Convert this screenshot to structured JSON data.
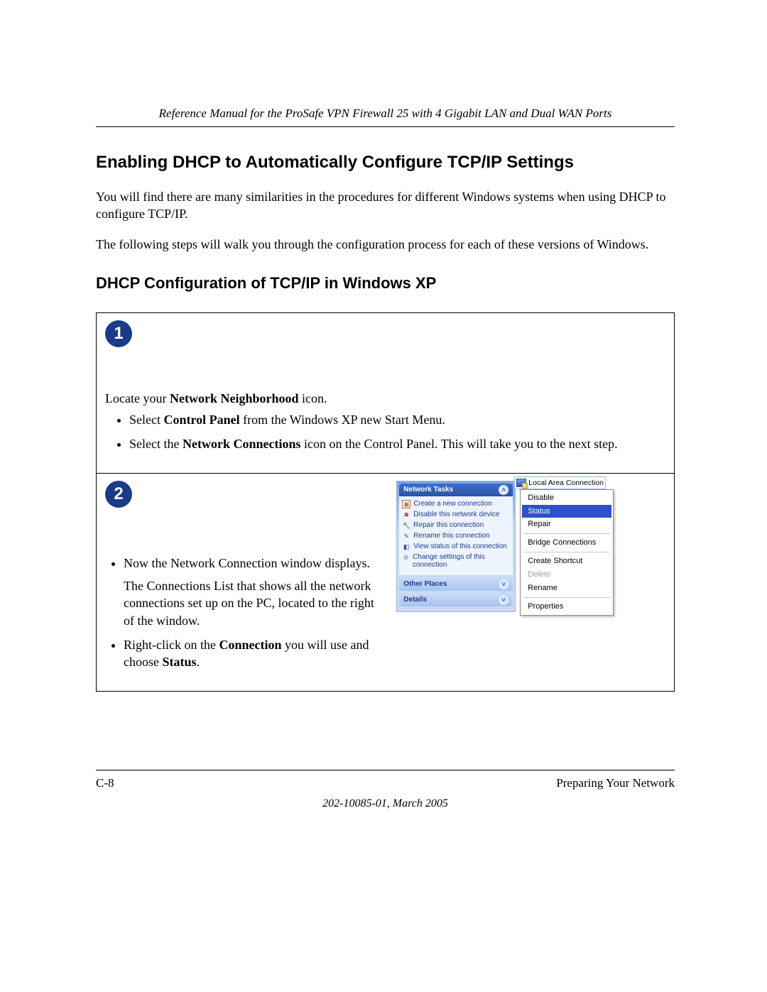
{
  "header": {
    "title": "Reference Manual for the ProSafe VPN Firewall 25 with 4 Gigabit LAN and Dual WAN Ports"
  },
  "section": {
    "heading": "Enabling DHCP to Automatically Configure TCP/IP Settings",
    "para1": "You will find there are many similarities in the procedures for different Windows systems when using DHCP to configure TCP/IP.",
    "para2": "The following steps will walk you through the configuration process for each of these versions of Windows."
  },
  "subsection": {
    "heading": "DHCP Configuration of TCP/IP in Windows XP"
  },
  "step1": {
    "badge": "1",
    "intro_pre": "Locate your ",
    "intro_bold": "Network Neighborhood",
    "intro_post": " icon.",
    "b1_pre": "Select ",
    "b1_bold": "Control Panel",
    "b1_post": " from the Windows XP new Start Menu.",
    "b2_pre": "Select the ",
    "b2_bold": "Network Connections",
    "b2_post": " icon on the Control Panel.  This will take you to the next step."
  },
  "step2": {
    "badge": "2",
    "b1": "Now the Network Connection window displays.",
    "b1b": "The Connections List that shows all the network connections set up on the PC, located to the right of the window.",
    "b2_pre": "Right-click on the ",
    "b2_bold": "Connection",
    "b2_mid": " you will use and choose ",
    "b2_bold2": "Status",
    "b2_post": "."
  },
  "xp": {
    "tasks_header": "Network Tasks",
    "links": [
      "Create a new connection",
      "Disable this network device",
      "Repair this connection",
      "Rename this connection",
      "View status of this connection",
      "Change settings of this connection"
    ],
    "other_places": "Other Places",
    "details": "Details"
  },
  "lan": {
    "label": "Local Area Connection"
  },
  "ctx": {
    "disable": "Disable",
    "status": "Status",
    "repair": "Repair",
    "bridge": "Bridge Connections",
    "shortcut": "Create Shortcut",
    "delete": "Delete",
    "rename": "Rename",
    "properties": "Properties"
  },
  "footer": {
    "left": "C-8",
    "right": "Preparing Your Network",
    "center": "202-10085-01, March 2005"
  }
}
